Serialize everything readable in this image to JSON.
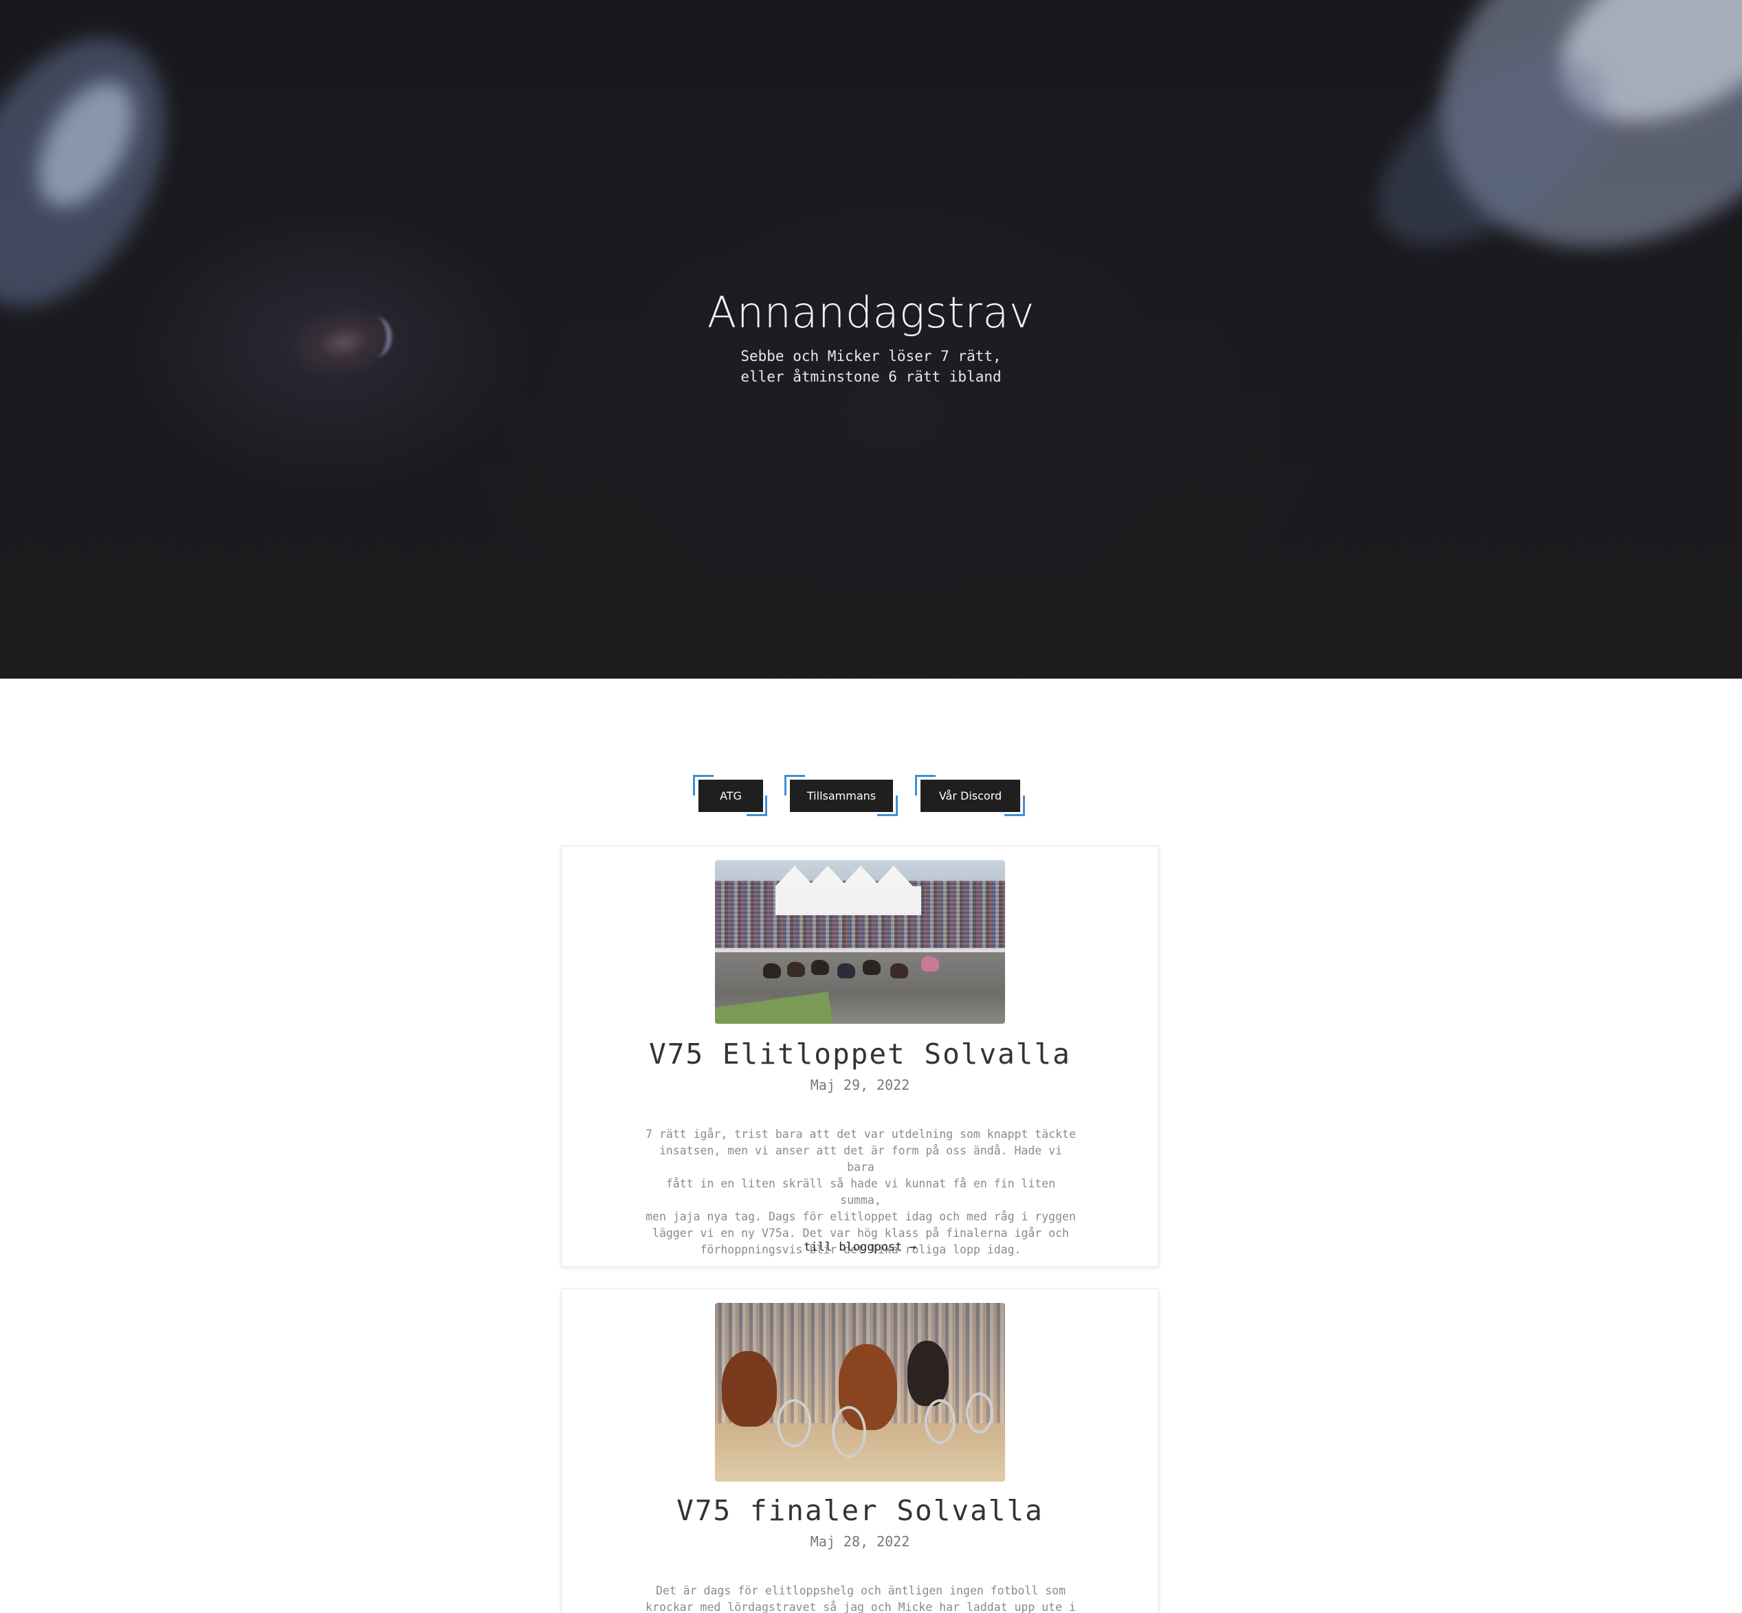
{
  "hero": {
    "title": "Annandagstrav",
    "subtitle_line1": "Sebbe och Micker löser 7 rätt,",
    "subtitle_line2": "eller åtminstone 6 rätt ibland"
  },
  "nav": {
    "buttons": [
      {
        "label": "ATG"
      },
      {
        "label": "Tillsammans"
      },
      {
        "label": "Vår Discord"
      }
    ]
  },
  "posts": [
    {
      "title": "V75 Elitloppet Solvalla",
      "date": "Maj 29, 2022",
      "excerpt_lines": [
        "7 rätt igår, trist bara att det var utdelning som knappt täckte",
        "insatsen, men vi anser att det är form på oss ändå. Hade vi bara",
        "fått in en liten skräll så hade vi kunnat få en fin liten summa,",
        "men jaja nya tag. Dags för elitloppet idag och med råg i ryggen",
        "lägger vi en ny V75a. Det var hög klass på finalerna igår och",
        "förhoppningsvis blir det lika roliga lopp idag."
      ],
      "read_more": "till bloggpost →"
    },
    {
      "title": "V75 finaler Solvalla",
      "date": "Maj 28, 2022",
      "excerpt_lines": [
        "Det är dags för elitloppshelg och äntligen ingen fotboll som",
        "krockar med lördagstravet så jag och Micke har laddat upp ute i"
      ]
    }
  ],
  "colors": {
    "hero_bg": "#1b1a1e",
    "button_bg": "#1f1f1f",
    "corner_accent": "#3f8fd6"
  }
}
